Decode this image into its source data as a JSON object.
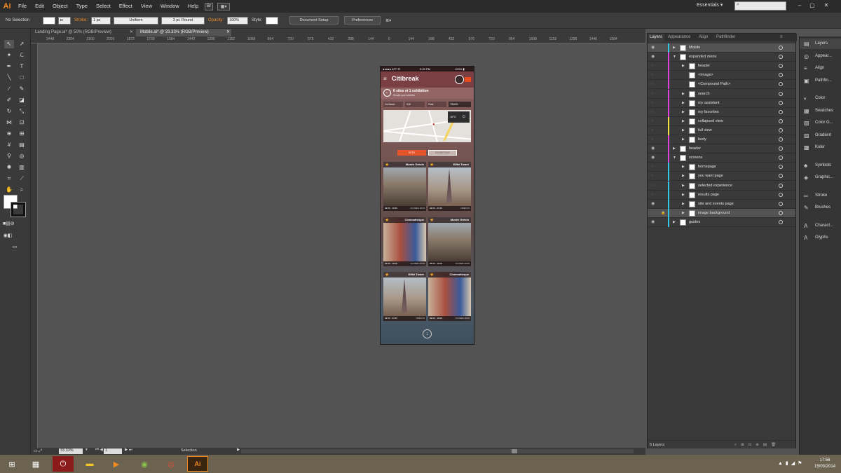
{
  "app": {
    "logo": "Ai",
    "menus": [
      "File",
      "Edit",
      "Object",
      "Type",
      "Select",
      "Effect",
      "View",
      "Window",
      "Help"
    ],
    "bridge": "Br",
    "workspace": "Essentials ▾"
  },
  "control": {
    "selection": "No Selection",
    "stroke_label": "Stroke:",
    "stroke_weight": "1 px",
    "profile": "Uniform",
    "brush": "3 pt. Round",
    "opacity_label": "Opacity:",
    "opacity": "100%",
    "style_label": "Style:",
    "doc_setup": "Document Setup",
    "preferences": "Preferences"
  },
  "tabs": [
    {
      "label": "Landing Page.ai* @ 50% (RGB/Preview)"
    },
    {
      "label": "Mobile.ai* @ 33.33% (RGB/Preview)"
    }
  ],
  "ruler": [
    "2448",
    "2304",
    "2160",
    "2016",
    "1872",
    "1728",
    "1584",
    "1440",
    "1296",
    "1152",
    "1008",
    "864",
    "720",
    "576",
    "432",
    "288",
    "144",
    "0",
    "144",
    "288",
    "432",
    "576",
    "720",
    "864",
    "1008",
    "1152",
    "1296",
    "1440",
    "1584"
  ],
  "status": {
    "zoom": "33.33%",
    "artboard": "1",
    "mode": "Selection"
  },
  "phone": {
    "carrier": "●●●●● ATT ☰",
    "time": "9:25 PM",
    "battery": "100% ▮",
    "title": "Citibreak",
    "summary_title": "6 sites et 1 exhibition",
    "summary_sub": "Results your selection",
    "filters": [
      "2rd March",
      "9:00",
      "Paris",
      "TRAVEL"
    ],
    "weather": "16°C",
    "seg_sites": "SITES",
    "seg_exhibitions": "EXHIBITIONS",
    "cards": [
      {
        "title": "Musée Grévin",
        "hours": "09:00 - 18:30",
        "status": "CLOSES 18:30"
      },
      {
        "title": "Eiffel Tower",
        "hours": "09:00 - 23:45",
        "status": "OPEN 00"
      },
      {
        "title": "Cinémathèque",
        "hours": "09:00 - 18:00",
        "status": "CLOSES 18:00"
      },
      {
        "title": "Musée Grévin",
        "hours": "09:00 - 18:30",
        "status": "CLOSES 18:30"
      },
      {
        "title": "Eiffel Tower",
        "hours": "09:00 - 23:45",
        "status": "OPEN 00"
      },
      {
        "title": "Cinémathèque",
        "hours": "09:00 - 18:00",
        "status": "CLOSES 18:00"
      }
    ]
  },
  "layers": {
    "tabs": [
      "Layers",
      "Appearance",
      "Align",
      "Pathfinder"
    ],
    "rows": [
      {
        "name": "Mobile",
        "color": "#33c4e6",
        "eye": true
      },
      {
        "name": "expanded menu",
        "color": "#e040e0",
        "eye": true
      },
      {
        "name": "header",
        "color": "#e040e0"
      },
      {
        "name": "<Image>",
        "color": "#e040e0"
      },
      {
        "name": "<Compound Path>",
        "color": "#e040e0"
      },
      {
        "name": "search",
        "color": "#e040e0"
      },
      {
        "name": "my assistant",
        "color": "#e040e0"
      },
      {
        "name": "my favorites",
        "color": "#e040e0"
      },
      {
        "name": "collapsed view",
        "color": "#f0e040"
      },
      {
        "name": "full view",
        "color": "#f0e040"
      },
      {
        "name": "body",
        "color": "#e040e0"
      },
      {
        "name": "header",
        "color": "#e040e0",
        "eye": true
      },
      {
        "name": "screens",
        "color": "#e040e0",
        "eye": true
      },
      {
        "name": "homepage",
        "color": "#33c4e6"
      },
      {
        "name": "you want page",
        "color": "#33c4e6"
      },
      {
        "name": "selected experience",
        "color": "#33c4e6"
      },
      {
        "name": "results page",
        "color": "#33c4e6"
      },
      {
        "name": "site and events page",
        "color": "#33c4e6",
        "eye": true
      },
      {
        "name": "image background",
        "color": "#33c4e6"
      },
      {
        "name": "guides",
        "color": "#33c4e6",
        "eye": true
      }
    ],
    "count": "5 Layers"
  },
  "dock": [
    {
      "label": "Layers",
      "icon": "▤"
    },
    {
      "label": "Appear...",
      "icon": "◎"
    },
    {
      "label": "Align",
      "icon": "≡"
    },
    {
      "label": "Pathfin...",
      "icon": "▣"
    },
    {
      "label": "Color",
      "icon": "◐"
    },
    {
      "label": "Swatches",
      "icon": "▦"
    },
    {
      "label": "Color G...",
      "icon": "▧"
    },
    {
      "label": "Gradient",
      "icon": "▨"
    },
    {
      "label": "Kuler",
      "icon": "▩"
    },
    {
      "label": "Symbols",
      "icon": "♣"
    },
    {
      "label": "Graphic...",
      "icon": "◈"
    },
    {
      "label": "Stroke",
      "icon": "═"
    },
    {
      "label": "Brushes",
      "icon": "✎"
    },
    {
      "label": "Charact...",
      "icon": "A"
    },
    {
      "label": "Glyphs",
      "icon": "А"
    }
  ],
  "clock": {
    "time": "17:56",
    "date": "15/03/2014"
  }
}
